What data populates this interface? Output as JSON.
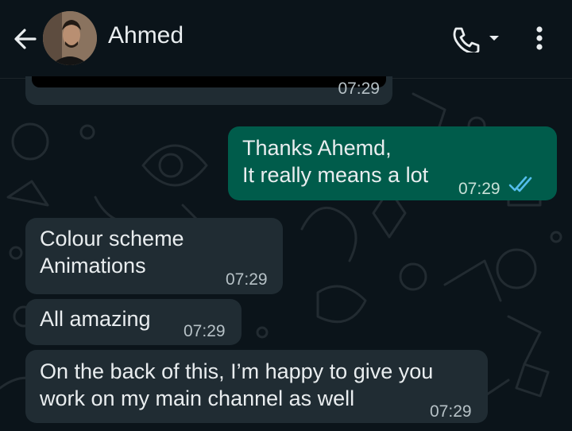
{
  "header": {
    "contact_name": "Ahmed",
    "back_icon": "arrow-left-icon",
    "call_icon": "phone-icon",
    "menu_icon": "more-vertical-icon"
  },
  "colors": {
    "background": "#0b141a",
    "incoming_bubble": "#202c33",
    "outgoing_bubble": "#005c4b",
    "read_ticks": "#53bdeb"
  },
  "messages": [
    {
      "direction": "incoming",
      "type": "media",
      "time": "07:29"
    },
    {
      "direction": "outgoing",
      "lines": [
        "Thanks Ahemd,",
        "It really means a lot"
      ],
      "time": "07:29",
      "status": "read"
    },
    {
      "direction": "incoming",
      "lines": [
        "Colour scheme",
        "Animations"
      ],
      "time": "07:29"
    },
    {
      "direction": "incoming",
      "lines": [
        "All amazing"
      ],
      "time": "07:29"
    },
    {
      "direction": "incoming",
      "lines": [
        "On the back of this, I’m happy to give you",
        "work on my main channel as well"
      ],
      "time": "07:29"
    }
  ]
}
